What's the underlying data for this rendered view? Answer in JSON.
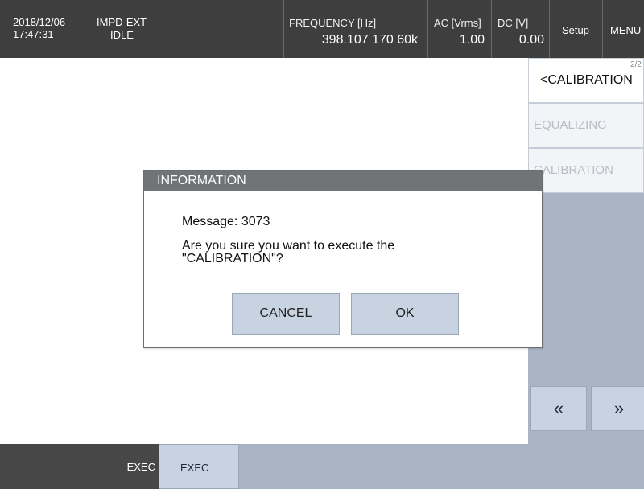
{
  "header": {
    "date": "2018/12/06",
    "time": "17:47:31",
    "mode": "IMPD-EXT",
    "state": "IDLE",
    "frequency_label": "FREQUENCY [Hz]",
    "frequency_value": "398.107 170 60k",
    "ac_label": "AC [Vrms]",
    "ac_value": "1.00",
    "dc_label": "DC [V]",
    "dc_value": "0.00",
    "setup_label": "Setup",
    "menu_label": "MENU"
  },
  "right_panel": {
    "back_glyph": "<",
    "title": "CALIBRATION",
    "page": "2/2",
    "items": [
      {
        "label": "EQUALIZING"
      },
      {
        "label": "CALIBRATION"
      }
    ],
    "prev_glyph": "«",
    "next_glyph": "»"
  },
  "bottom_bar": {
    "exec_left": "EXEC",
    "exec_right": "EXEC"
  },
  "dialog": {
    "title": "INFORMATION",
    "message": "Message: 3073",
    "question": "Are you sure you want to execute the \"CALIBRATION\"?",
    "cancel_label": "CANCEL",
    "ok_label": "OK"
  }
}
